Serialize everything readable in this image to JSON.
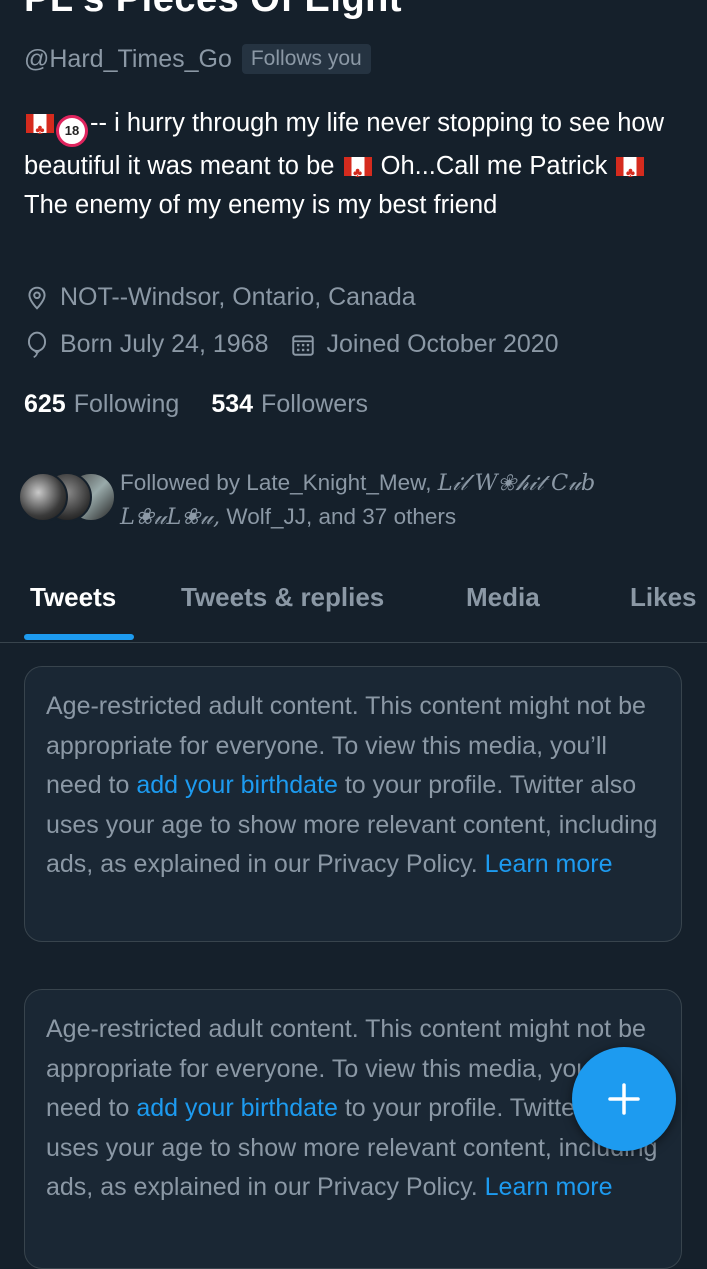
{
  "profile": {
    "display_name": "PL's Pieces Of Eight",
    "handle": "@Hard_Times_Go",
    "follows_you": "Follows you",
    "bio": {
      "part1": "-- i hurry through my life never stopping to see how beautiful it was meant to be",
      "part2": "Oh...Call me Patrick",
      "part3": "The enemy of my enemy is my best friend"
    },
    "location": "NOT--Windsor, Ontario, Canada",
    "birthday": "Born July 24, 1968",
    "joined": "Joined October 2020",
    "following_count": "625",
    "following_label": "Following",
    "followers_count": "534",
    "followers_label": "Followers",
    "followed_by": {
      "prefix": "Followed by Late_Knight_Mew,",
      "fancy1": "L𝒾𝓁 W❀𝒽𝒾𝓉 C𝓊b",
      "fancy2": "L❀𝓊L❀𝓊,",
      "suffix": "Wolf_JJ, and 37 others"
    }
  },
  "tabs": [
    {
      "label": "Tweets",
      "active": true
    },
    {
      "label": "Tweets & replies",
      "active": false
    },
    {
      "label": "Media",
      "active": false
    },
    {
      "label": "Likes",
      "active": false
    }
  ],
  "notice": {
    "text_a": "Age-restricted adult content. This content might not be appropriate for everyone. To view this media, you’ll need to",
    "link_birthdate": "add your birthdate",
    "text_b": "to your profile. Twitter also uses your age to show more relevant content, including ads, as explained in our Privacy Policy.",
    "link_learn": "Learn more"
  },
  "icons": {
    "location": "location-pin-icon",
    "birthday": "balloon-icon",
    "joined": "calendar-icon",
    "compose": "plus-icon"
  },
  "colors": {
    "background": "#15202b",
    "accent": "#1d9bf0",
    "secondary_text": "#8b98a5"
  }
}
